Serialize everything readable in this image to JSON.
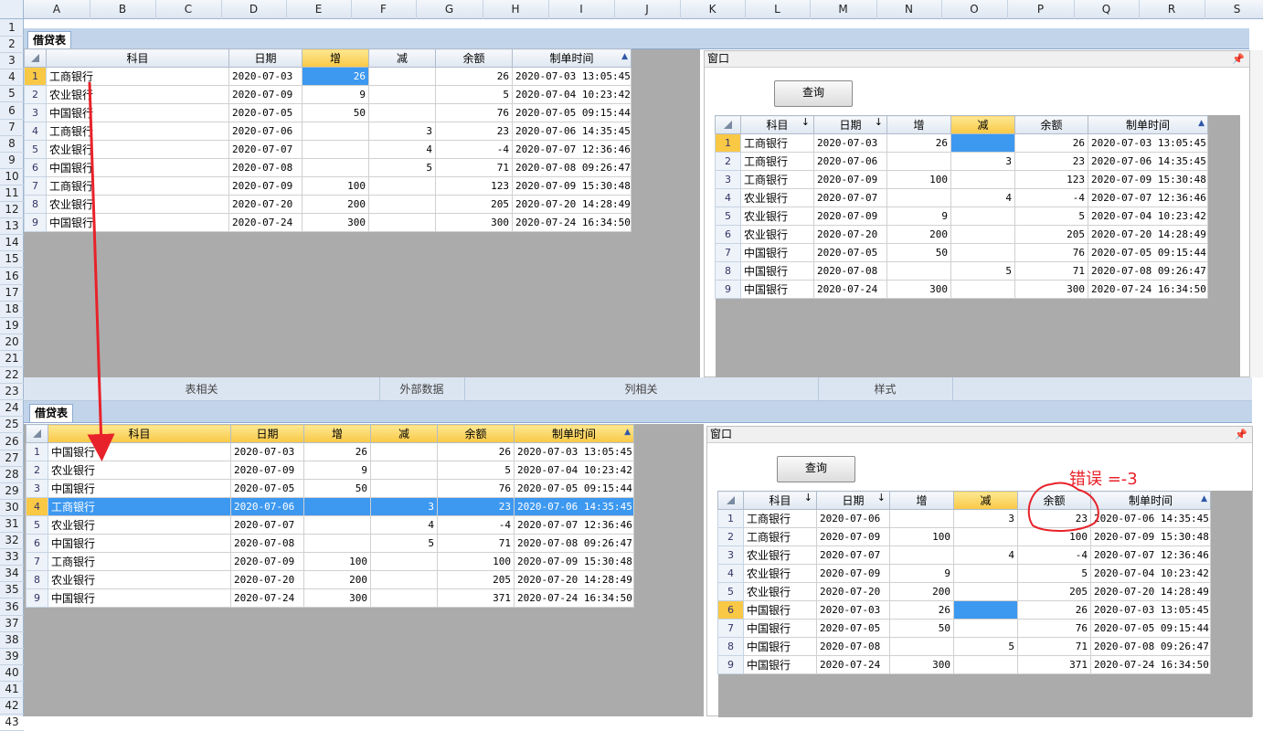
{
  "excel": {
    "columns": [
      "A",
      "B",
      "C",
      "D",
      "E",
      "F",
      "G",
      "H",
      "I",
      "J",
      "K",
      "L",
      "M",
      "N",
      "O",
      "P",
      "Q",
      "R",
      "S"
    ],
    "rows": [
      "1",
      "2",
      "3",
      "4",
      "5",
      "6",
      "7",
      "8",
      "9",
      "10",
      "11",
      "12",
      "13",
      "14",
      "15",
      "16",
      "17",
      "18",
      "19",
      "20",
      "21",
      "22",
      "23",
      "24",
      "25",
      "26",
      "27",
      "28",
      "29",
      "30",
      "31",
      "32",
      "33",
      "34",
      "35",
      "36",
      "37",
      "38",
      "39",
      "40",
      "41",
      "42",
      "43"
    ]
  },
  "ribbon": {
    "groups": [
      "表相关",
      "外部数据",
      "列相关",
      "样式"
    ]
  },
  "sheet_tab": "借贷表",
  "window": {
    "title": "窗口",
    "pin": "📌",
    "query_button": "查询"
  },
  "headers": {
    "subject": "科目",
    "date": "日期",
    "increase": "增",
    "decrease": "减",
    "balance": "余额",
    "created": "制单时间",
    "sort_arrow": "↓"
  },
  "top_left_rows": [
    {
      "n": "1",
      "subject": "工商银行",
      "date": "2020-07-03",
      "inc": "26",
      "dec": "",
      "bal": "26",
      "time": "2020-07-03 13:05:45"
    },
    {
      "n": "2",
      "subject": "农业银行",
      "date": "2020-07-09",
      "inc": "9",
      "dec": "",
      "bal": "5",
      "time": "2020-07-04 10:23:42"
    },
    {
      "n": "3",
      "subject": "中国银行",
      "date": "2020-07-05",
      "inc": "50",
      "dec": "",
      "bal": "76",
      "time": "2020-07-05 09:15:44"
    },
    {
      "n": "4",
      "subject": "工商银行",
      "date": "2020-07-06",
      "inc": "",
      "dec": "3",
      "bal": "23",
      "time": "2020-07-06 14:35:45"
    },
    {
      "n": "5",
      "subject": "农业银行",
      "date": "2020-07-07",
      "inc": "",
      "dec": "4",
      "bal": "-4",
      "time": "2020-07-07 12:36:46"
    },
    {
      "n": "6",
      "subject": "中国银行",
      "date": "2020-07-08",
      "inc": "",
      "dec": "5",
      "bal": "71",
      "time": "2020-07-08 09:26:47"
    },
    {
      "n": "7",
      "subject": "工商银行",
      "date": "2020-07-09",
      "inc": "100",
      "dec": "",
      "bal": "123",
      "time": "2020-07-09 15:30:48"
    },
    {
      "n": "8",
      "subject": "农业银行",
      "date": "2020-07-20",
      "inc": "200",
      "dec": "",
      "bal": "205",
      "time": "2020-07-20 14:28:49"
    },
    {
      "n": "9",
      "subject": "中国银行",
      "date": "2020-07-24",
      "inc": "300",
      "dec": "",
      "bal": "300",
      "time": "2020-07-24 16:34:50"
    }
  ],
  "top_right_rows": [
    {
      "n": "1",
      "subject": "工商银行",
      "date": "2020-07-03",
      "inc": "26",
      "dec": "",
      "bal": "26",
      "time": "2020-07-03 13:05:45"
    },
    {
      "n": "2",
      "subject": "工商银行",
      "date": "2020-07-06",
      "inc": "",
      "dec": "3",
      "bal": "23",
      "time": "2020-07-06 14:35:45"
    },
    {
      "n": "3",
      "subject": "工商银行",
      "date": "2020-07-09",
      "inc": "100",
      "dec": "",
      "bal": "123",
      "time": "2020-07-09 15:30:48"
    },
    {
      "n": "4",
      "subject": "农业银行",
      "date": "2020-07-07",
      "inc": "",
      "dec": "4",
      "bal": "-4",
      "time": "2020-07-07 12:36:46"
    },
    {
      "n": "5",
      "subject": "农业银行",
      "date": "2020-07-09",
      "inc": "9",
      "dec": "",
      "bal": "5",
      "time": "2020-07-04 10:23:42"
    },
    {
      "n": "6",
      "subject": "农业银行",
      "date": "2020-07-20",
      "inc": "200",
      "dec": "",
      "bal": "205",
      "time": "2020-07-20 14:28:49"
    },
    {
      "n": "7",
      "subject": "中国银行",
      "date": "2020-07-05",
      "inc": "50",
      "dec": "",
      "bal": "76",
      "time": "2020-07-05 09:15:44"
    },
    {
      "n": "8",
      "subject": "中国银行",
      "date": "2020-07-08",
      "inc": "",
      "dec": "5",
      "bal": "71",
      "time": "2020-07-08 09:26:47"
    },
    {
      "n": "9",
      "subject": "中国银行",
      "date": "2020-07-24",
      "inc": "300",
      "dec": "",
      "bal": "300",
      "time": "2020-07-24 16:34:50"
    }
  ],
  "bottom_left_rows": [
    {
      "n": "1",
      "subject": "中国银行",
      "date": "2020-07-03",
      "inc": "26",
      "dec": "",
      "bal": "26",
      "time": "2020-07-03 13:05:45"
    },
    {
      "n": "2",
      "subject": "农业银行",
      "date": "2020-07-09",
      "inc": "9",
      "dec": "",
      "bal": "5",
      "time": "2020-07-04 10:23:42"
    },
    {
      "n": "3",
      "subject": "中国银行",
      "date": "2020-07-05",
      "inc": "50",
      "dec": "",
      "bal": "76",
      "time": "2020-07-05 09:15:44"
    },
    {
      "n": "4",
      "subject": "工商银行",
      "date": "2020-07-06",
      "inc": "",
      "dec": "3",
      "bal": "23",
      "time": "2020-07-06 14:35:45"
    },
    {
      "n": "5",
      "subject": "农业银行",
      "date": "2020-07-07",
      "inc": "",
      "dec": "4",
      "bal": "-4",
      "time": "2020-07-07 12:36:46"
    },
    {
      "n": "6",
      "subject": "中国银行",
      "date": "2020-07-08",
      "inc": "",
      "dec": "5",
      "bal": "71",
      "time": "2020-07-08 09:26:47"
    },
    {
      "n": "7",
      "subject": "工商银行",
      "date": "2020-07-09",
      "inc": "100",
      "dec": "",
      "bal": "100",
      "time": "2020-07-09 15:30:48"
    },
    {
      "n": "8",
      "subject": "农业银行",
      "date": "2020-07-20",
      "inc": "200",
      "dec": "",
      "bal": "205",
      "time": "2020-07-20 14:28:49"
    },
    {
      "n": "9",
      "subject": "中国银行",
      "date": "2020-07-24",
      "inc": "300",
      "dec": "",
      "bal": "371",
      "time": "2020-07-24 16:34:50"
    }
  ],
  "bottom_right_rows": [
    {
      "n": "1",
      "subject": "工商银行",
      "date": "2020-07-06",
      "inc": "",
      "dec": "3",
      "bal": "23",
      "time": "2020-07-06 14:35:45"
    },
    {
      "n": "2",
      "subject": "工商银行",
      "date": "2020-07-09",
      "inc": "100",
      "dec": "",
      "bal": "100",
      "time": "2020-07-09 15:30:48"
    },
    {
      "n": "3",
      "subject": "农业银行",
      "date": "2020-07-07",
      "inc": "",
      "dec": "4",
      "bal": "-4",
      "time": "2020-07-07 12:36:46"
    },
    {
      "n": "4",
      "subject": "农业银行",
      "date": "2020-07-09",
      "inc": "9",
      "dec": "",
      "bal": "5",
      "time": "2020-07-04 10:23:42"
    },
    {
      "n": "5",
      "subject": "农业银行",
      "date": "2020-07-20",
      "inc": "200",
      "dec": "",
      "bal": "205",
      "time": "2020-07-20 14:28:49"
    },
    {
      "n": "6",
      "subject": "中国银行",
      "date": "2020-07-03",
      "inc": "26",
      "dec": "",
      "bal": "26",
      "time": "2020-07-03 13:05:45"
    },
    {
      "n": "7",
      "subject": "中国银行",
      "date": "2020-07-05",
      "inc": "50",
      "dec": "",
      "bal": "76",
      "time": "2020-07-05 09:15:44"
    },
    {
      "n": "8",
      "subject": "中国银行",
      "date": "2020-07-08",
      "inc": "",
      "dec": "5",
      "bal": "71",
      "time": "2020-07-08 09:26:47"
    },
    {
      "n": "9",
      "subject": "中国银行",
      "date": "2020-07-24",
      "inc": "300",
      "dec": "",
      "bal": "371",
      "time": "2020-07-24 16:34:50"
    }
  ],
  "annotation": {
    "text": "错误  =-3",
    "color": "#e8222a"
  },
  "colors": {
    "selection": "#3d98f0",
    "header_active": "#f9c845",
    "panel_gray": "#ababab",
    "ribbon": "#dbe5f1"
  }
}
